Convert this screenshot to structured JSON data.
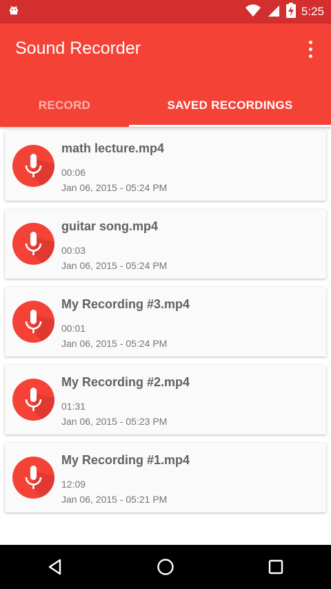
{
  "status_bar": {
    "time": "5:25",
    "icons": [
      "android-debug-icon",
      "wifi-icon",
      "signal-icon",
      "battery-charging-icon"
    ]
  },
  "app_bar": {
    "title": "Sound Recorder",
    "menu_icon": "overflow-menu-icon",
    "color": "#f44336"
  },
  "tabs": [
    {
      "label": "RECORD",
      "selected": false
    },
    {
      "label": "SAVED RECORDINGS",
      "selected": true
    }
  ],
  "recordings": [
    {
      "name": "math lecture.mp4",
      "length": "00:06",
      "date": "Jan 06, 2015 - 05:24 PM"
    },
    {
      "name": "guitar song.mp4",
      "length": "00:03",
      "date": "Jan 06, 2015 - 05:24 PM"
    },
    {
      "name": "My Recording #3.mp4",
      "length": "00:01",
      "date": "Jan 06, 2015 - 05:24 PM"
    },
    {
      "name": "My Recording #2.mp4",
      "length": "01:31",
      "date": "Jan 06, 2015 - 05:23 PM"
    },
    {
      "name": "My Recording #1.mp4",
      "length": "12:09",
      "date": "Jan 06, 2015 - 05:21 PM"
    }
  ],
  "nav_bar": {
    "buttons": [
      "back-icon",
      "home-icon",
      "recents-icon"
    ]
  }
}
